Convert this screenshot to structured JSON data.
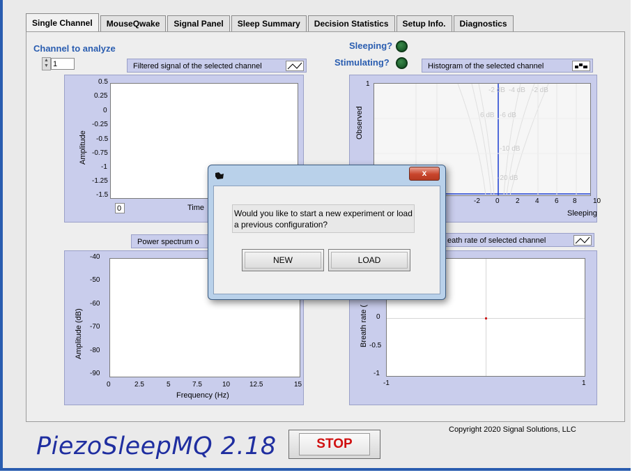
{
  "tabs": [
    {
      "label": "Single Channel",
      "active": true
    },
    {
      "label": "MouseQwake",
      "active": false
    },
    {
      "label": "Signal Panel",
      "active": false
    },
    {
      "label": "Sleep Summary",
      "active": false
    },
    {
      "label": "Decision Statistics",
      "active": false
    },
    {
      "label": "Setup Info.",
      "active": false
    },
    {
      "label": "Diagnostics",
      "active": false
    }
  ],
  "channel": {
    "label": "Channel to analyze",
    "value": "1"
  },
  "indicators": {
    "sleeping": "Sleeping?",
    "stimulating": "Stimulating?"
  },
  "graphs": {
    "filtered": {
      "title": "Filtered signal of the selected channel",
      "ylabel": "Amplitude",
      "xlabel": "Time",
      "yticks": [
        "0.5",
        "0.25",
        "0",
        "-0.25",
        "-0.5",
        "-0.75",
        "-1",
        "-1.25",
        "-1.5"
      ],
      "xticks": [
        "0"
      ]
    },
    "histogram": {
      "title": "Histogram of the selected channel",
      "ylabel": "Observed",
      "xlabel": "Sleeping",
      "yticks": [
        "1"
      ],
      "xticks": [
        "-2",
        "0",
        "2",
        "4",
        "6",
        "8",
        "10"
      ],
      "contour_labels": [
        "-2 dB",
        "-4 dB",
        "-2 dB",
        "6 dB",
        "-6 dB",
        "-10 dB",
        "-20 dB"
      ]
    },
    "power": {
      "title": "Power spectrum of the selected channel",
      "title_visible": "Power spectrum o",
      "ylabel": "Amplitude (dB)",
      "xlabel": "Frequency (Hz)",
      "yticks": [
        "-40",
        "-50",
        "-60",
        "-70",
        "-80",
        "-90"
      ],
      "xticks": [
        "0",
        "2.5",
        "5",
        "7.5",
        "10",
        "12.5",
        "15"
      ]
    },
    "breath": {
      "title_visible": "eath rate of selected channel",
      "ylabel": "Breath rate (",
      "yticks": [
        "0",
        "-0.5",
        "-1"
      ],
      "xticks": [
        "-1",
        "1"
      ]
    }
  },
  "brand": "PiezoSleepMQ 2.18",
  "stop_label": "STOP",
  "copyright": "Copyright 2020 Signal Solutions, LLC",
  "dialog": {
    "close_glyph": "x",
    "message": "Would you like to start a new experiment or load a previous configuration?",
    "new_label": "NEW",
    "load_label": "LOAD"
  }
}
